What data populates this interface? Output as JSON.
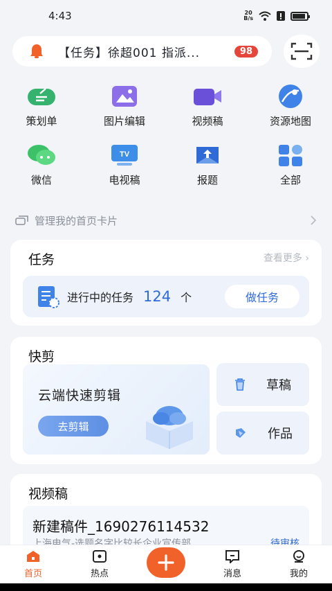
{
  "status_bar": {
    "time": "4:43",
    "speed_value": "20",
    "speed_unit": "B/s",
    "battery_level": 0.9
  },
  "notice": {
    "text": "【任务】徐超001 指派...",
    "badge": "98"
  },
  "grid": [
    {
      "label": "策划单",
      "icon": "plan-icon"
    },
    {
      "label": "图片编辑",
      "icon": "image-edit-icon"
    },
    {
      "label": "视频稿",
      "icon": "video-icon"
    },
    {
      "label": "资源地图",
      "icon": "resource-map-icon"
    },
    {
      "label": "微信",
      "icon": "wechat-icon"
    },
    {
      "label": "电视稿",
      "icon": "tv-icon"
    },
    {
      "label": "报题",
      "icon": "report-icon"
    },
    {
      "label": "全部",
      "icon": "all-icon"
    }
  ],
  "manage": {
    "label": "管理我的首页卡片"
  },
  "task_card": {
    "title": "任务",
    "more": "查看更多",
    "row_label": "进行中的任务",
    "count": "124",
    "unit": "个",
    "button": "做任务"
  },
  "clip_card": {
    "title": "快剪",
    "cloud_title": "云端快速剪辑",
    "cloud_button": "去剪辑",
    "draft_label": "草稿",
    "works_label": "作品"
  },
  "video_card": {
    "title": "视频稿",
    "item_name": "新建稿件_1690276114532",
    "item_sub": "上海电气-选题名字比较长企业宣传部",
    "item_status": "待审核"
  },
  "tabbar": [
    {
      "label": "首页",
      "icon": "home-icon",
      "active": true
    },
    {
      "label": "热点",
      "icon": "hot-icon",
      "active": false
    },
    {
      "label": "消息",
      "icon": "message-icon",
      "active": false
    },
    {
      "label": "我的",
      "icon": "profile-icon",
      "active": false
    }
  ],
  "colors": {
    "accent": "#f0622a",
    "blue": "#2f6ad6",
    "background": "#f2f4f7"
  }
}
